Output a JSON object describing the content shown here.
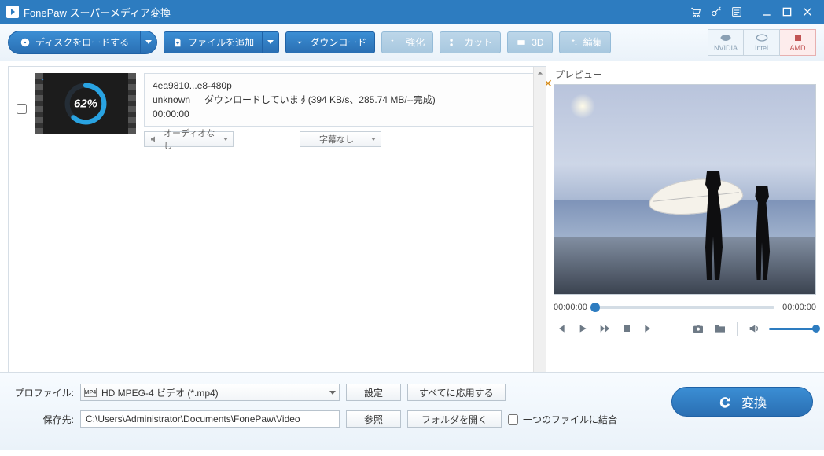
{
  "titlebar": {
    "title": "FonePaw スーパーメディア変換"
  },
  "toolbar": {
    "loadDisc": "ディスクをロードする",
    "addFile": "ファイルを追加",
    "download": "ダウンロード",
    "enhance": "強化",
    "cut": "カット",
    "threeD": "3D",
    "edit": "編集"
  },
  "gpu": {
    "nvidia": "NVIDIA",
    "intel": "Intel",
    "amd": "AMD"
  },
  "item": {
    "filename": "4ea9810...e8-480p",
    "meta": "unknown",
    "duration": "00:00:00",
    "status": "ダウンロードしています(394 KB/s、285.74 MB/--完成)",
    "progressPct": "62%",
    "progress": 62,
    "audioNone": "オーディオなし",
    "subtitleNone": "字幕なし"
  },
  "preview": {
    "label": "プレビュー",
    "timeCurrent": "00:00:00",
    "timeTotal": "00:00:00"
  },
  "footer": {
    "profileLabel": "プロファイル:",
    "profileValue": "HD MPEG-4 ビデオ (*.mp4)",
    "settings": "設定",
    "applyAll": "すべてに応用する",
    "saveLabel": "保存先:",
    "savePath": "C:\\Users\\Administrator\\Documents\\FonePaw\\Video",
    "browse": "参照",
    "openFolder": "フォルダを開く",
    "mergeOne": "一つのファイルに結合",
    "convert": "変換"
  }
}
